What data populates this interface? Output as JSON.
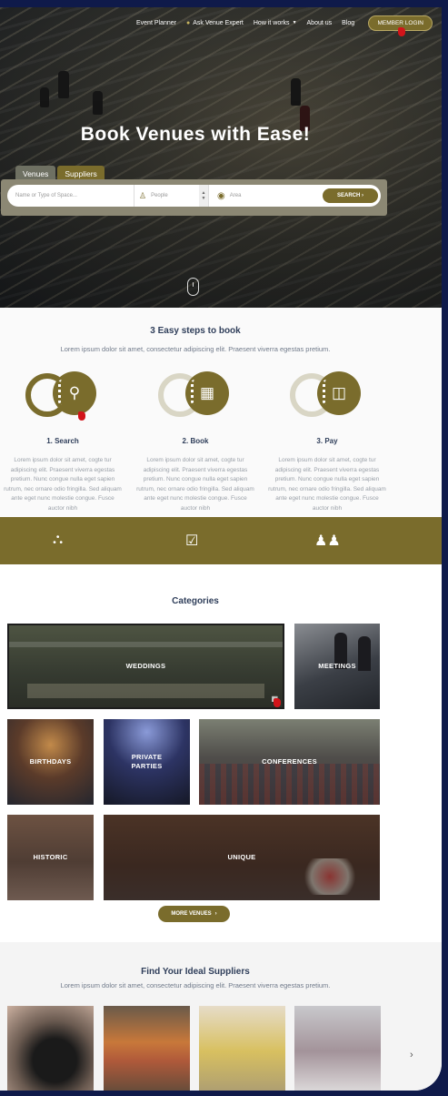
{
  "nav": {
    "items": [
      "Event Planner",
      "Ask Venue Expert",
      "How it works",
      "About us",
      "Blog"
    ],
    "login": "MEMBER LOGIN"
  },
  "hero": {
    "title": "Book Venues with Ease!",
    "tabs": [
      "Venues",
      "Suppliers"
    ],
    "search": {
      "name_placeholder": "Name or Type of Space...",
      "people_placeholder": "People",
      "area_placeholder": "Area",
      "button": "SEARCH"
    }
  },
  "steps": {
    "title": "3 Easy steps to book",
    "subtitle": "Lorem ipsum dolor sit amet, consectetur adipiscing elit. Praesent viverra egestas pretium.",
    "items": [
      {
        "title": "1. Search",
        "text": "Lorem ipsum dolor sit amet, cogte tur adipiscing elit. Praesent viverra egestas pretium. Nunc congue nulla eget sapien rutrum, nec ornare odio fringilla. Sed aliquam ante eget nunc molestie congue. Fusce auctor nibh",
        "icon": "search-icon"
      },
      {
        "title": "2. Book",
        "text": "Lorem ipsum dolor sit amet, cogte tur adipiscing elit. Praesent viverra egestas pretium. Nunc congue nulla eget sapien rutrum, nec ornare odio fringilla. Sed aliquam ante eget nunc molestie congue. Fusce auctor nibh",
        "icon": "calendar-check-icon"
      },
      {
        "title": "3. Pay",
        "text": "Lorem ipsum dolor sit amet, cogte tur adipiscing elit. Praesent viverra egestas pretium. Nunc congue nulla eget sapien rutrum, nec ornare odio fringilla. Sed aliquam ante eget nunc molestie congue. Fusce auctor nibh",
        "icon": "ticket-icon"
      }
    ]
  },
  "band_icons": [
    "venue-location-icon",
    "checkbox-icon",
    "group-icon"
  ],
  "categories": {
    "title": "Categories",
    "tiles": [
      "WEDDINGS",
      "MEETINGS",
      "BIRTHDAYS",
      "PRIVATE PARTIES",
      "CONFERENCES",
      "HISTORIC",
      "UNIQUE"
    ],
    "more": "MORE VENUES"
  },
  "suppliers": {
    "title": "Find Your Ideal Suppliers",
    "subtitle": "Lorem ipsum dolor sit amet, consectetur adipiscing elit. Praesent viverra egestas pretium."
  },
  "colors": {
    "brand": "#7a6c2c",
    "frame": "#0f1a4a",
    "heading": "#2f3e5a"
  }
}
